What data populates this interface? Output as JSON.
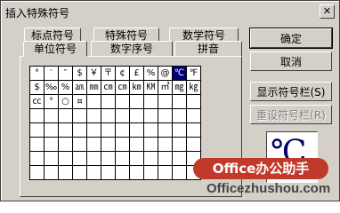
{
  "title": "插入特殊符号",
  "close_glyph": "✕",
  "tabs_back": [
    "标点符号",
    "特殊符号",
    "数学符号"
  ],
  "tabs_front": [
    "单位符号",
    "数字序号",
    "拼音"
  ],
  "grid": [
    [
      "°",
      "′",
      "″",
      "$",
      "￥",
      "〒",
      "¢",
      "£",
      "%",
      "@",
      "℃",
      "℉"
    ],
    [
      "$",
      "‰",
      "%",
      "㏂",
      "㎜",
      "㎝",
      "㎝",
      "㎞",
      "㏎",
      "㎡",
      "㎎",
      "㎏"
    ],
    [
      "㏄",
      "°",
      "○",
      "¤",
      "",
      "",
      "",
      "",
      "",
      "",
      "",
      ""
    ],
    [
      "",
      "",
      "",
      "",
      "",
      "",
      "",
      "",
      "",
      "",
      "",
      ""
    ],
    [
      "",
      "",
      "",
      "",
      "",
      "",
      "",
      "",
      "",
      "",
      "",
      ""
    ],
    [
      "",
      "",
      "",
      "",
      "",
      "",
      "",
      "",
      "",
      "",
      "",
      ""
    ],
    [
      "",
      "",
      "",
      "",
      "",
      "",
      "",
      "",
      "",
      "",
      "",
      ""
    ],
    [
      "",
      "",
      "",
      "",
      "",
      "",
      "",
      "",
      "",
      "",
      "",
      ""
    ]
  ],
  "selected_cell": {
    "row": 0,
    "col": 10
  },
  "buttons": {
    "ok": "确定",
    "cancel": "取消",
    "show_toolbar": "显示符号栏(S)",
    "reset_toolbar": "重设符号栏(R)"
  },
  "preview_symbol": "℃",
  "watermark": {
    "badge": "Office办公助手",
    "url": "Officezhushou.com"
  }
}
